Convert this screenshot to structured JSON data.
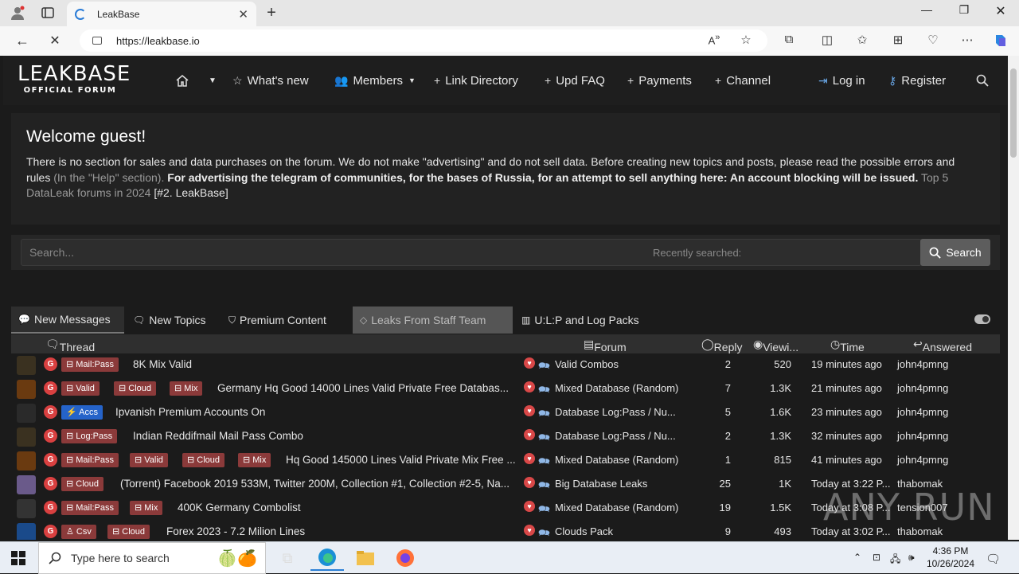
{
  "browser": {
    "tab_title": "LeakBase",
    "url": "https://leakbase.io"
  },
  "site": {
    "logo_main": "LEAKBASE",
    "logo_sub": "OFFICIAL FORUM",
    "nav": [
      "What's new",
      "Members",
      "Link Directory",
      "Upd FAQ",
      "Payments",
      "Channel"
    ],
    "login": "Log in",
    "register": "Register"
  },
  "welcome": {
    "title": "Welcome guest!",
    "text1": "There is no section for sales and data purchases on the forum. We do not make \"advertising\" and do not sell data. Before creating new topics and posts, please read the possible errors and rules",
    "text2": "(In the \"Help\" section).",
    "text3": "For advertising the telegram of communities, for the bases of Russia, for an attempt to sell anything here: An account blocking will be issued.",
    "text4": "Top 5 DataLeak forums in 2024",
    "text5": "[#2. LeakBase]"
  },
  "search": {
    "placeholder": "Search...",
    "recent": "Recently searched:",
    "button": "Search"
  },
  "tabs": [
    "New Messages",
    "New Topics",
    "Premium Content",
    "Leaks From Staff Team",
    "U:L:P and Log Packs"
  ],
  "columns": {
    "thread": "Thread",
    "forum": "Forum",
    "reply": "Reply",
    "views": "Viewi...",
    "time": "Time",
    "answered": "Answered"
  },
  "rows": [
    {
      "tags": [
        "Mail:Pass"
      ],
      "title": "8K Mix Valid",
      "forum": "Valid Combos",
      "reply": "2",
      "views": "520",
      "time": "19 minutes ago",
      "user": "john4pmng"
    },
    {
      "tags": [
        "Valid",
        "Cloud",
        "Mix"
      ],
      "title": "Germany Hq Good 14000 Lines Valid Private Free Databas...",
      "forum": "Mixed Database (Random)",
      "reply": "7",
      "views": "1.3K",
      "time": "21 minutes ago",
      "user": "john4pmng"
    },
    {
      "tags": [
        "Accs"
      ],
      "title": "Ipvanish Premium Accounts On",
      "forum": "Database Log:Pass / Nu...",
      "reply": "5",
      "views": "1.6K",
      "time": "23 minutes ago",
      "user": "john4pmng"
    },
    {
      "tags": [
        "Log:Pass"
      ],
      "title": "Indian Reddifmail Mail Pass Combo",
      "forum": "Database Log:Pass / Nu...",
      "reply": "2",
      "views": "1.3K",
      "time": "32 minutes ago",
      "user": "john4pmng"
    },
    {
      "tags": [
        "Mail:Pass",
        "Valid",
        "Cloud",
        "Mix"
      ],
      "title": "Hq Good 145000 Lines Valid Private Mix Free ...",
      "forum": "Mixed Database (Random)",
      "reply": "1",
      "views": "815",
      "time": "41 minutes ago",
      "user": "john4pmng"
    },
    {
      "tags": [
        "Cloud"
      ],
      "title": "(Torrent) Facebook 2019 533M, Twitter 200M, Collection #1, Collection #2-5, Na...",
      "forum": "Big Database Leaks",
      "reply": "25",
      "views": "1K",
      "time": "Today at 3:22 P...",
      "user": "thabomak"
    },
    {
      "tags": [
        "Mail:Pass",
        "Mix"
      ],
      "title": "400K Germany Combolist",
      "forum": "Mixed Database (Random)",
      "reply": "19",
      "views": "1.5K",
      "time": "Today at 3:08 P...",
      "user": "tension007"
    },
    {
      "tags": [
        "Csv",
        "Cloud"
      ],
      "title": "Forex 2023 - 7.2 Milion Lines",
      "forum": "Clouds Pack",
      "reply": "9",
      "views": "493",
      "time": "Today at 3:02 P...",
      "user": "thabomak"
    }
  ],
  "watermark": "ANY RUN",
  "taskbar": {
    "search_placeholder": "Type here to search",
    "time": "4:36 PM",
    "date": "10/26/2024"
  }
}
